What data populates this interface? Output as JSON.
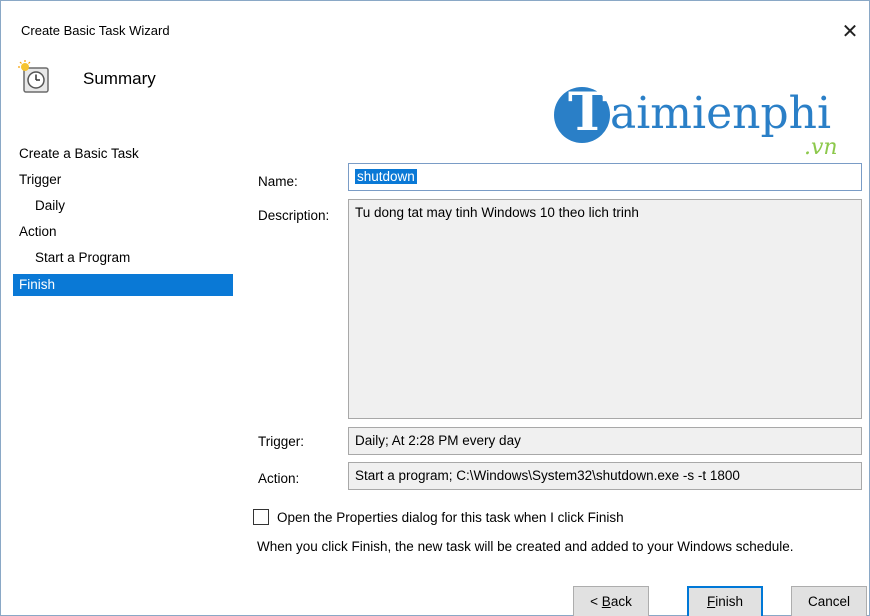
{
  "window": {
    "title": "Create Basic Task Wizard",
    "close_glyph": "✕"
  },
  "header": {
    "icon": "clock-task-icon",
    "title": "Summary"
  },
  "watermark": {
    "letter": "T",
    "word": "aimienphi",
    "suffix": ".vn"
  },
  "nav": {
    "items": [
      {
        "label": "Create a Basic Task",
        "sub": false,
        "active": false
      },
      {
        "label": "Trigger",
        "sub": false,
        "active": false
      },
      {
        "label": "Daily",
        "sub": true,
        "active": false
      },
      {
        "label": "Action",
        "sub": false,
        "active": false
      },
      {
        "label": "Start a Program",
        "sub": true,
        "active": false
      },
      {
        "label": "Finish",
        "sub": false,
        "active": true
      }
    ]
  },
  "form": {
    "name_label": "Name:",
    "name_value": "shutdown",
    "description_label": "Description:",
    "description_value": "Tu dong tat may tinh Windows 10 theo lich trinh",
    "trigger_label": "Trigger:",
    "trigger_value": "Daily; At 2:28 PM every day",
    "action_label": "Action:",
    "action_value": "Start a program; C:\\Windows\\System32\\shutdown.exe -s -t 1800"
  },
  "options": {
    "open_properties_label": "Open the Properties dialog for this task when I click Finish",
    "open_properties_checked": false,
    "note": "When you click Finish, the new task will be created and added to your Windows schedule."
  },
  "buttons": {
    "back_prefix": "< ",
    "back_mnemonic": "B",
    "back_rest": "ack",
    "finish_mnemonic": "F",
    "finish_rest": "inish",
    "cancel": "Cancel"
  },
  "colors": {
    "selection": "#0a79d6",
    "logo_blue": "#2a7fc7",
    "logo_green": "#8cc84b"
  }
}
